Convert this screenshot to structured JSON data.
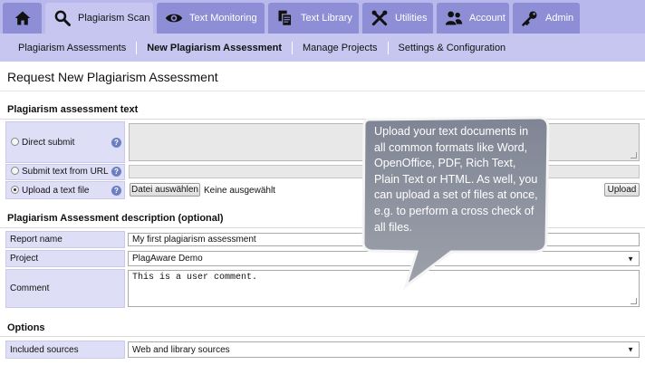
{
  "nav": {
    "tabs": [
      {
        "label": "Plagiarism Scan",
        "icon": "search-icon"
      },
      {
        "label": "Text Monitoring",
        "icon": "eye-icon"
      },
      {
        "label": "Text Library",
        "icon": "documents-icon"
      },
      {
        "label": "Utilities",
        "icon": "tools-icon"
      },
      {
        "label": "Account",
        "icon": "users-icon"
      },
      {
        "label": "Admin",
        "icon": "key-icon"
      }
    ],
    "home_icon": "home-icon",
    "subnav": [
      "Plagiarism Assessments",
      "New Plagiarism Assessment",
      "Manage Projects",
      "Settings & Configuration"
    ]
  },
  "page": {
    "title": "Request New Plagiarism Assessment"
  },
  "text_section": {
    "heading": "Plagiarism assessment text",
    "direct_submit": "Direct submit",
    "submit_url": "Submit text from URL",
    "upload_file": "Upload a text file",
    "choose_button": "Datei auswählen",
    "no_file": "Keine ausgewählt",
    "upload_button": "Upload"
  },
  "description_section": {
    "heading": "Plagiarism Assessment description (optional)",
    "report_name_label": "Report name",
    "report_name_value": "My first plagiarism assessment",
    "project_label": "Project",
    "project_value": "PlagAware Demo",
    "comment_label": "Comment",
    "comment_value": "This is a user comment."
  },
  "options_section": {
    "heading": "Options",
    "included_sources_label": "Included sources",
    "included_sources_value": "Web and library sources"
  },
  "callout": {
    "text": "Upload your text documents in all common formats like Word, OpenOffice, PDF, Rich Text, Plain Text or HTML. As well, you can upload a set of files at once, e.g. to perform a cross check of all files."
  },
  "colors": {
    "tab_bg": "#8e8ed6",
    "tab_active_bg": "#c6c6f0",
    "label_bg": "#dedef6",
    "help_icon": "#6d7fc2",
    "callout_bg": "#8a8f9c"
  }
}
